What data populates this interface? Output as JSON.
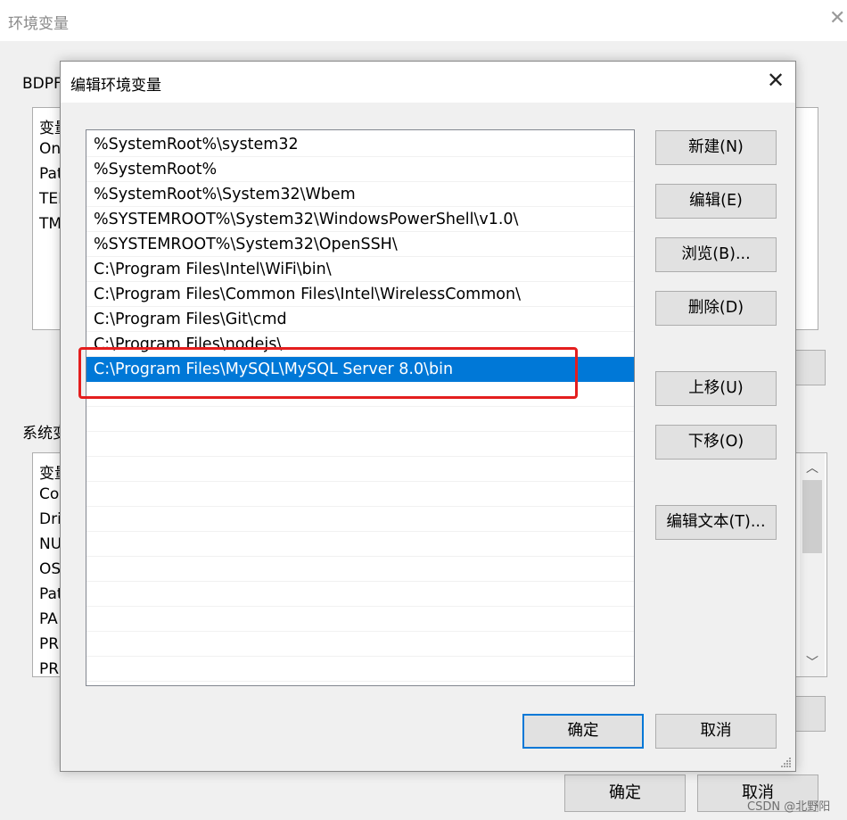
{
  "background_window": {
    "title": "环境变量",
    "close_glyph": "✕",
    "user_group_label": "BDPF",
    "user_list_header": "变量",
    "user_list_items": [
      "On",
      "Pat",
      "TEI",
      "TM"
    ],
    "system_group_label": "系统变",
    "system_list_header": "变量",
    "system_list_items": [
      "Co",
      "Dri",
      "NU",
      "OS",
      "Pat",
      "PA",
      "PR",
      "PR"
    ],
    "ok_button": "确定",
    "cancel_button": "取消"
  },
  "dialog": {
    "title": "编辑环境变量",
    "close_glyph": "✕",
    "paths": [
      "%SystemRoot%\\system32",
      "%SystemRoot%",
      "%SystemRoot%\\System32\\Wbem",
      "%SYSTEMROOT%\\System32\\WindowsPowerShell\\v1.0\\",
      "%SYSTEMROOT%\\System32\\OpenSSH\\",
      "C:\\Program Files\\Intel\\WiFi\\bin\\",
      "C:\\Program Files\\Common Files\\Intel\\WirelessCommon\\",
      "C:\\Program Files\\Git\\cmd",
      "C:\\Program Files\\nodejs\\",
      "C:\\Program Files\\MySQL\\MySQL Server 8.0\\bin"
    ],
    "selected_index": 9,
    "empty_rows": 12,
    "buttons": {
      "new": "新建(N)",
      "edit": "编辑(E)",
      "browse": "浏览(B)...",
      "delete": "删除(D)",
      "move_up": "上移(U)",
      "move_down": "下移(O)",
      "edit_text": "编辑文本(T)...",
      "ok": "确定",
      "cancel": "取消"
    },
    "selection_color": "#0078d7",
    "annotation_color": "#e41e1e"
  },
  "watermark": "CSDN @北野阳"
}
